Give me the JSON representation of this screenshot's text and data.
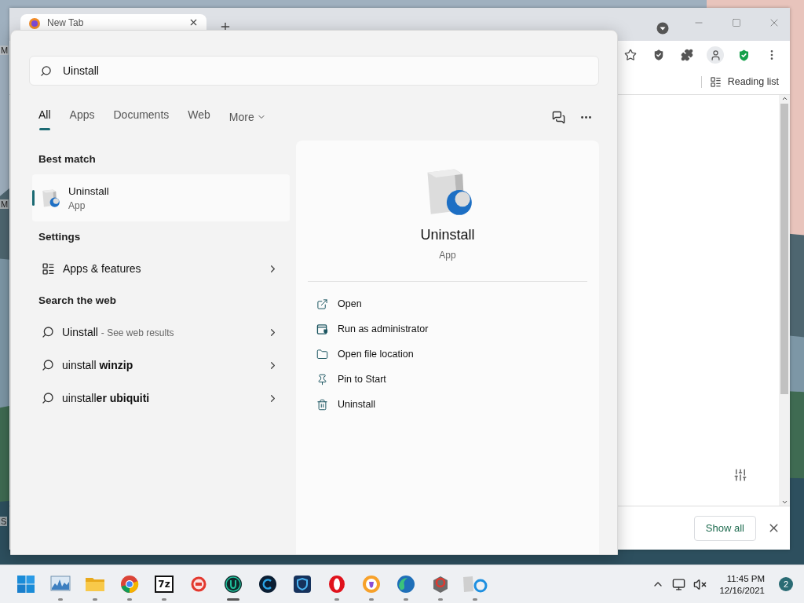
{
  "desktop": {
    "labels": [
      "M",
      "M",
      "S"
    ]
  },
  "browser": {
    "tab": {
      "title": "New Tab"
    },
    "reading_list": "Reading list",
    "downloads_bar": {
      "button": "Show all"
    }
  },
  "search": {
    "query": "Uinstall",
    "filters": [
      {
        "label": "All",
        "selected": true
      },
      {
        "label": "Apps",
        "selected": false
      },
      {
        "label": "Documents",
        "selected": false
      },
      {
        "label": "Web",
        "selected": false
      }
    ],
    "more": "More",
    "best_match": {
      "heading": "Best match",
      "name": "Uninstall",
      "type": "App",
      "selected": true
    },
    "settings": {
      "heading": "Settings",
      "items": [
        {
          "label": "Apps & features"
        }
      ]
    },
    "web": {
      "heading": "Search the web",
      "items": [
        {
          "text": "Uinstall",
          "hint": "- See web results"
        },
        {
          "text": "uinstall **winzip**"
        },
        {
          "text": "uinstall**er ubiquiti**"
        }
      ]
    },
    "preview": {
      "name": "Uninstall",
      "type": "App",
      "actions": [
        {
          "kind": "open",
          "label": "Open"
        },
        {
          "kind": "admin",
          "label": "Run as administrator"
        },
        {
          "kind": "folder",
          "label": "Open file location"
        },
        {
          "kind": "pin",
          "label": "Pin to Start"
        },
        {
          "kind": "trash",
          "label": "Uninstall"
        }
      ]
    }
  },
  "taskbar": {
    "apps": [
      {
        "kind": "start",
        "running": false,
        "active": false
      },
      {
        "kind": "monitor",
        "running": true,
        "active": false
      },
      {
        "kind": "folder",
        "running": true,
        "active": false
      },
      {
        "kind": "chrome",
        "running": true,
        "active": false
      },
      {
        "kind": "archive",
        "glyph": "7z",
        "running": true,
        "active": false
      },
      {
        "kind": "red-ring",
        "running": false,
        "active": false
      },
      {
        "kind": "u",
        "running": true,
        "active": true
      },
      {
        "kind": "c",
        "running": false,
        "active": false
      },
      {
        "kind": "shield",
        "running": false,
        "active": false
      },
      {
        "kind": "opera",
        "running": true,
        "active": false
      },
      {
        "kind": "brave",
        "running": true,
        "active": false
      },
      {
        "kind": "edge",
        "running": true,
        "active": false
      },
      {
        "kind": "box",
        "running": true,
        "active": false
      },
      {
        "kind": "uninstaller",
        "running": true,
        "active": false
      }
    ],
    "clock": {
      "time": "11:45 PM",
      "date": "12/16/2021"
    },
    "notifications": "2"
  }
}
